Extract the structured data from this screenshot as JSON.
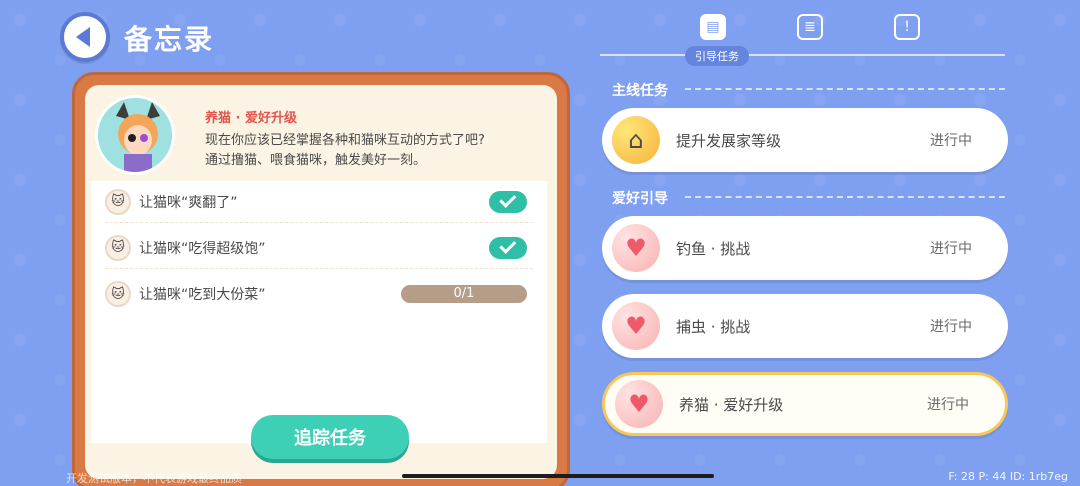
{
  "header": {
    "title": "备忘录",
    "back_icon": "back-arrow-icon"
  },
  "left_panel": {
    "hero": {
      "name": "养猫 · 爱好升级",
      "desc_line1": "现在你应该已经掌握各种和猫咪互动的方式了吧?",
      "desc_line2": "通过撸猫、喂食猫咪，触发美好一刻。"
    },
    "tasks": [
      {
        "label": "让猫咪“爽翻了”",
        "state": "done"
      },
      {
        "label": "让猫咪“吃得超级饱”",
        "state": "done"
      },
      {
        "label": "让猫咪“吃到大份菜”",
        "state": "progress",
        "progress_text": "0/1",
        "progress_value": 0
      }
    ],
    "track_button": "追踪任务"
  },
  "right_panel": {
    "tabs": [
      {
        "icon": "book-icon",
        "active": true
      },
      {
        "icon": "checklist-icon",
        "active": false
      },
      {
        "icon": "tip-icon",
        "active": false
      }
    ],
    "active_tab_label": "引导任务",
    "sections": [
      {
        "title": "主线任务",
        "items": [
          {
            "label": "提升发展家等级",
            "status": "进行中",
            "icon": "house-icon"
          }
        ]
      },
      {
        "title": "爱好引导",
        "items": [
          {
            "label": "钓鱼 · 挑战",
            "status": "进行中",
            "icon": "heart-icon"
          },
          {
            "label": "捕虫 · 挑战",
            "status": "进行中",
            "icon": "heart-icon"
          },
          {
            "label": "养猫 · 爱好升级",
            "status": "进行中",
            "icon": "heart-icon",
            "selected": true
          }
        ]
      }
    ]
  },
  "footer": {
    "left": "开发测试版本，不代表游戏最终品质",
    "right": "F: 28    P: 44    ID: 1rb7eg"
  }
}
